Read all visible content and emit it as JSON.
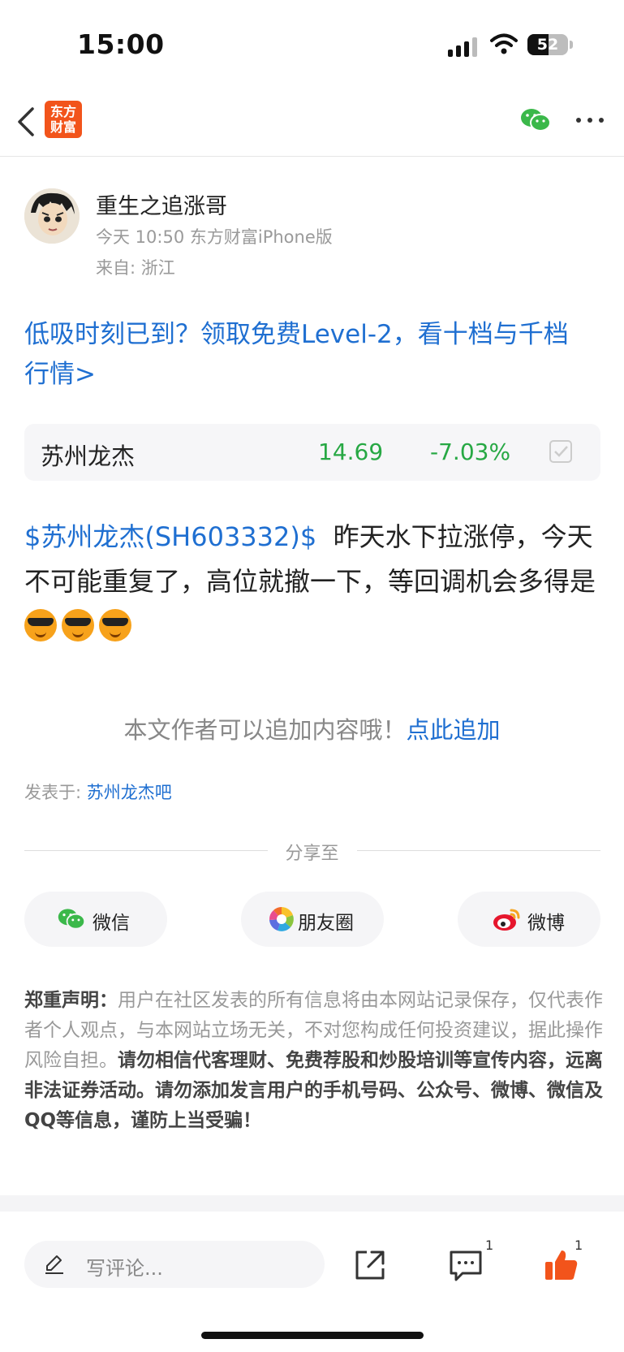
{
  "status_bar": {
    "time": "15:00",
    "battery": "52"
  },
  "nav": {
    "logo_line1": "东方",
    "logo_line2": "财富"
  },
  "author": {
    "name": "重生之追涨哥",
    "meta": "今天 10:50 东方财富iPhone版",
    "location": "来自: 浙江"
  },
  "promo": "低吸时刻已到？领取免费Level-2，看十档与千档行情>",
  "stock": {
    "name": "苏州龙杰",
    "price": "14.69",
    "change": "-7.03%"
  },
  "post": {
    "tag": "$苏州龙杰(SH603332)$",
    "text": "昨天水下拉涨停，今天不可能重复了，高位就撤一下，等回调机会多得是"
  },
  "append": {
    "text": "本文作者可以追加内容哦！",
    "link": "点此追加"
  },
  "posted_in": {
    "label": "发表于: ",
    "forum": "苏州龙杰吧"
  },
  "share": {
    "title": "分享至",
    "wechat": "微信",
    "moments": "朋友圈",
    "weibo": "微博"
  },
  "disclaimer": {
    "label": "郑重声明：",
    "text": "用户在社区发表的所有信息将由本网站记录保存，仅代表作者个人观点，与本网站立场无关，不对您构成任何投资建议，据此操作风险自担。",
    "bold": "请勿相信代客理财、免费荐股和炒股培训等宣传内容，远离非法证券活动。请勿添加发言用户的手机号码、公众号、微博、微信及QQ等信息，谨防上当受骗！"
  },
  "bottom_bar": {
    "comment_placeholder": "写评论...",
    "comment_count": "1",
    "like_count": "1"
  },
  "colors": {
    "link": "#1f6fd1",
    "down": "#27a844",
    "brand": "#f2541b",
    "like": "#f2541b"
  }
}
